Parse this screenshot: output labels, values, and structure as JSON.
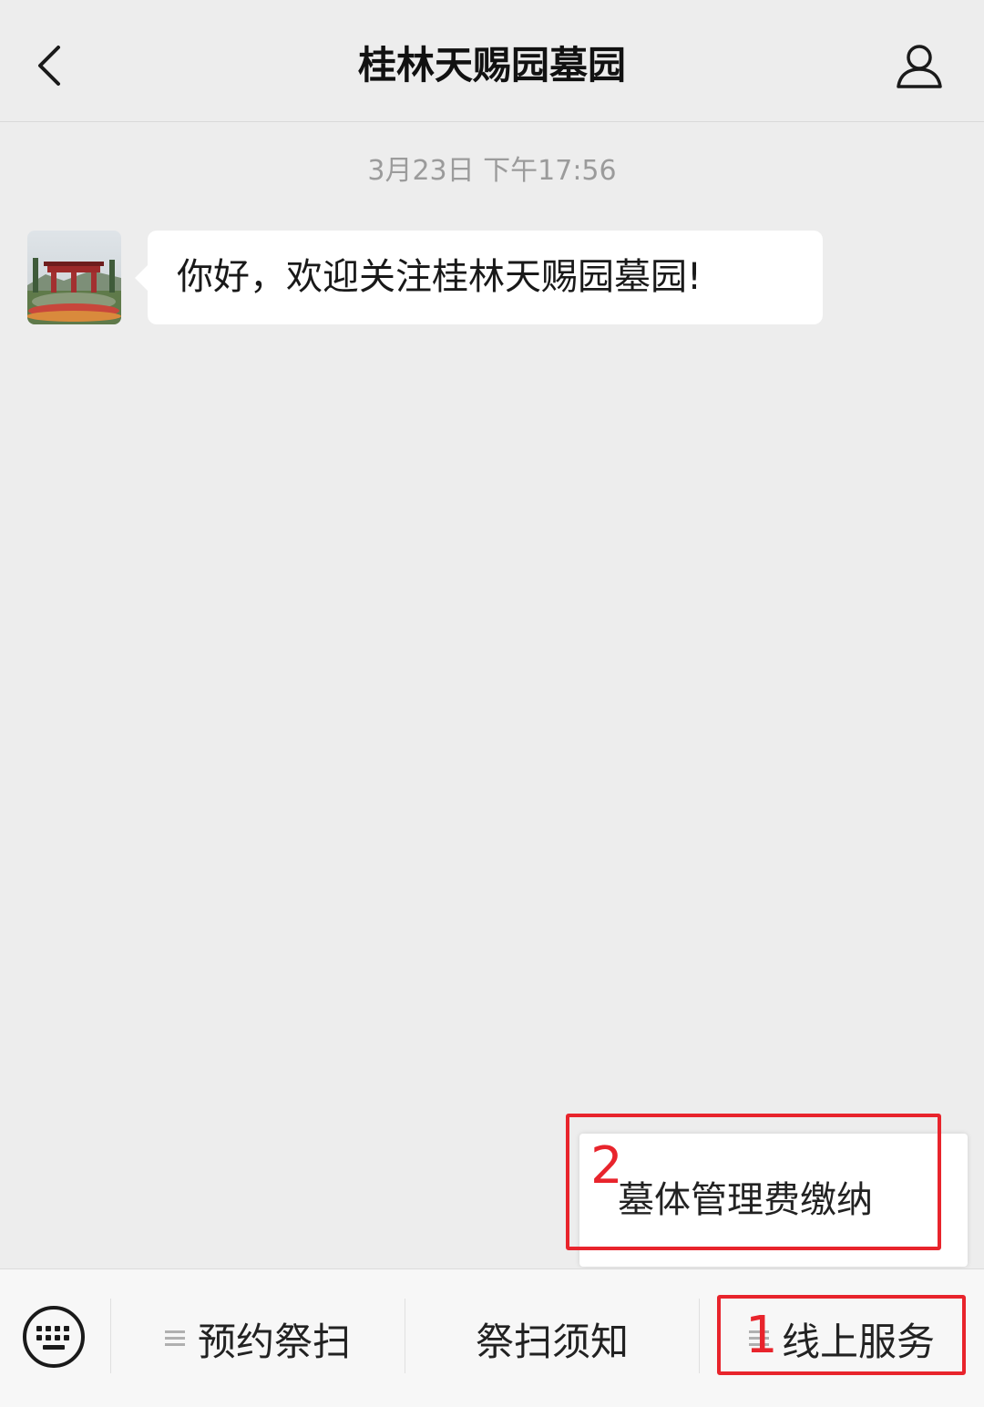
{
  "header": {
    "title": "桂林天赐园墓园"
  },
  "timestamp": "3月23日 下午17:56",
  "messages": [
    {
      "sender": "account",
      "text": "你好，欢迎关注桂林天赐园墓园!"
    }
  ],
  "submenu": {
    "items": [
      "墓体管理费缴纳"
    ]
  },
  "menu": {
    "tabs": [
      {
        "label": "预约祭扫",
        "has_submenu": true
      },
      {
        "label": "祭扫须知",
        "has_submenu": false
      },
      {
        "label": "线上服务",
        "has_submenu": true
      }
    ]
  },
  "annotations": [
    {
      "number": "1",
      "target": "线上服务"
    },
    {
      "number": "2",
      "target": "墓体管理费缴纳"
    }
  ],
  "colors": {
    "background": "#ededed",
    "bubble": "#ffffff",
    "annotation": "#e8242c",
    "timestamp": "#9b9b9b"
  },
  "icons": [
    "back-arrow-icon",
    "user-profile-icon",
    "keyboard-icon",
    "menu-lines-icon"
  ]
}
